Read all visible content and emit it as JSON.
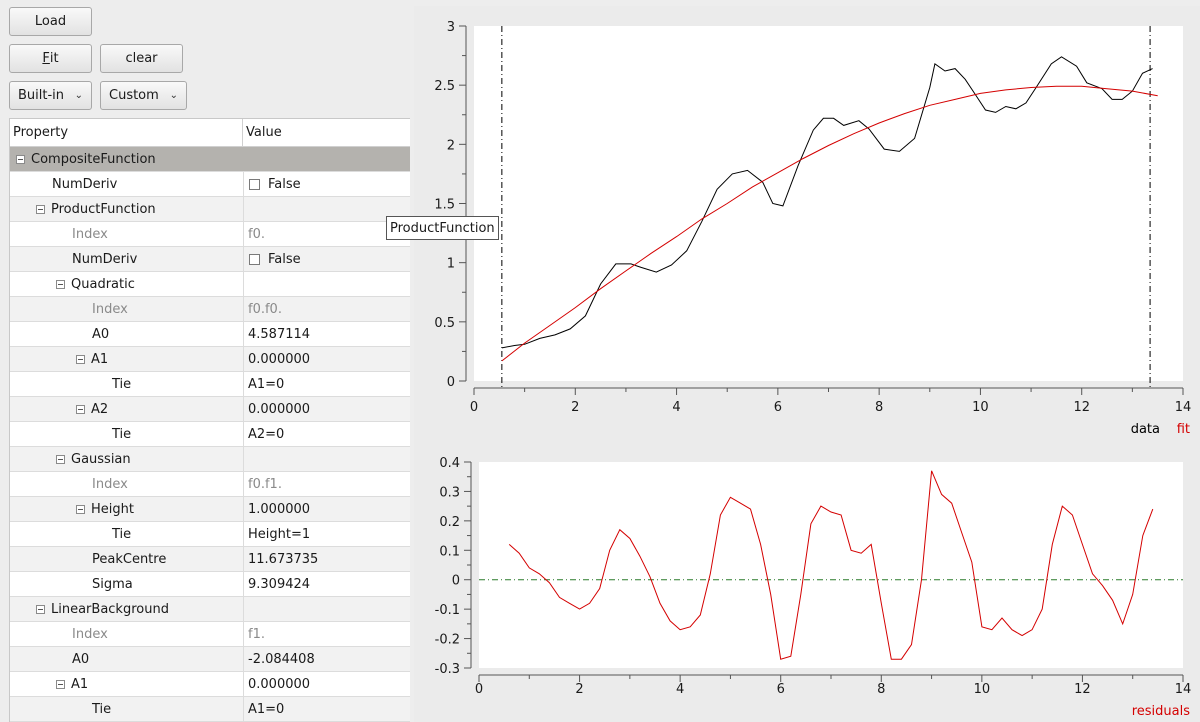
{
  "toolbar": {
    "load_label": "Load",
    "fit_label_underlined": "F",
    "fit_label_rest": "it",
    "clear_label": "clear",
    "builtin_label": "Built-in",
    "custom_label": "Custom"
  },
  "table": {
    "header_property": "Property",
    "header_value": "Value",
    "rows": [
      {
        "indent": 0,
        "label": "CompositeFunction",
        "value": "",
        "type": "group",
        "expander": true
      },
      {
        "indent": 1,
        "label": "NumDeriv",
        "value": "False",
        "type": "checkbox"
      },
      {
        "indent": 1,
        "label": "ProductFunction",
        "value": "",
        "expander": true
      },
      {
        "indent": 2,
        "label": "Index",
        "value": "f0.",
        "dim": true
      },
      {
        "indent": 2,
        "label": "NumDeriv",
        "value": "False",
        "type": "checkbox"
      },
      {
        "indent": 2,
        "label": "Quadratic",
        "value": "",
        "expander": true
      },
      {
        "indent": 3,
        "label": "Index",
        "value": "f0.f0.",
        "dim": true
      },
      {
        "indent": 3,
        "label": "A0",
        "value": "4.587114"
      },
      {
        "indent": 3,
        "label": "A1",
        "value": "0.000000",
        "expander": true
      },
      {
        "indent": 4,
        "label": "Tie",
        "value": "A1=0"
      },
      {
        "indent": 3,
        "label": "A2",
        "value": "0.000000",
        "expander": true
      },
      {
        "indent": 4,
        "label": "Tie",
        "value": "A2=0"
      },
      {
        "indent": 2,
        "label": "Gaussian",
        "value": "",
        "expander": true
      },
      {
        "indent": 3,
        "label": "Index",
        "value": "f0.f1.",
        "dim": true
      },
      {
        "indent": 3,
        "label": "Height",
        "value": "1.000000",
        "expander": true
      },
      {
        "indent": 4,
        "label": "Tie",
        "value": "Height=1"
      },
      {
        "indent": 3,
        "label": "PeakCentre",
        "value": "11.673735"
      },
      {
        "indent": 3,
        "label": "Sigma",
        "value": "9.309424"
      },
      {
        "indent": 1,
        "label": "LinearBackground",
        "value": "",
        "expander": true
      },
      {
        "indent": 2,
        "label": "Index",
        "value": "f1.",
        "dim": true
      },
      {
        "indent": 2,
        "label": "A0",
        "value": "-2.084408"
      },
      {
        "indent": 2,
        "label": "A1",
        "value": "0.000000",
        "expander": true
      },
      {
        "indent": 3,
        "label": "Tie",
        "value": "A1=0"
      }
    ]
  },
  "tooltip": "ProductFunction",
  "colors": {
    "data": "#000000",
    "fit": "#d40000",
    "residuals": "#d40000",
    "zero_line": "#2a7a2a",
    "marker": "#000000"
  },
  "chart_data": [
    {
      "type": "line",
      "xlim": [
        0,
        14
      ],
      "ylim": [
        0,
        3
      ],
      "xticks": [
        0,
        2,
        4,
        6,
        8,
        10,
        12,
        14
      ],
      "yticks": [
        0,
        0.5,
        1,
        1.5,
        2,
        2.5,
        3
      ],
      "legend": {
        "items": [
          "data",
          "fit"
        ],
        "placement": "bottom-right"
      },
      "range_markers": [
        0.55,
        13.35
      ],
      "series": [
        {
          "name": "data",
          "color": "#000000",
          "points": [
            [
              0.55,
              0.28
            ],
            [
              0.8,
              0.3
            ],
            [
              1.0,
              0.31
            ],
            [
              1.3,
              0.36
            ],
            [
              1.6,
              0.39
            ],
            [
              1.9,
              0.44
            ],
            [
              2.2,
              0.55
            ],
            [
              2.5,
              0.82
            ],
            [
              2.8,
              0.99
            ],
            [
              3.1,
              0.99
            ],
            [
              3.3,
              0.96
            ],
            [
              3.6,
              0.92
            ],
            [
              3.9,
              0.98
            ],
            [
              4.2,
              1.1
            ],
            [
              4.5,
              1.35
            ],
            [
              4.8,
              1.62
            ],
            [
              5.1,
              1.75
            ],
            [
              5.4,
              1.78
            ],
            [
              5.7,
              1.68
            ],
            [
              5.9,
              1.5
            ],
            [
              6.1,
              1.48
            ],
            [
              6.4,
              1.82
            ],
            [
              6.7,
              2.12
            ],
            [
              6.9,
              2.22
            ],
            [
              7.1,
              2.22
            ],
            [
              7.3,
              2.16
            ],
            [
              7.6,
              2.2
            ],
            [
              7.8,
              2.13
            ],
            [
              8.1,
              1.96
            ],
            [
              8.4,
              1.94
            ],
            [
              8.7,
              2.05
            ],
            [
              9.0,
              2.48
            ],
            [
              9.1,
              2.68
            ],
            [
              9.3,
              2.62
            ],
            [
              9.5,
              2.64
            ],
            [
              9.7,
              2.55
            ],
            [
              9.9,
              2.42
            ],
            [
              10.1,
              2.29
            ],
            [
              10.3,
              2.27
            ],
            [
              10.5,
              2.32
            ],
            [
              10.7,
              2.3
            ],
            [
              10.9,
              2.35
            ],
            [
              11.1,
              2.48
            ],
            [
              11.4,
              2.68
            ],
            [
              11.6,
              2.74
            ],
            [
              11.9,
              2.66
            ],
            [
              12.1,
              2.52
            ],
            [
              12.4,
              2.47
            ],
            [
              12.6,
              2.38
            ],
            [
              12.8,
              2.38
            ],
            [
              13.0,
              2.45
            ],
            [
              13.2,
              2.6
            ],
            [
              13.4,
              2.64
            ]
          ]
        },
        {
          "name": "fit",
          "color": "#d40000",
          "points": [
            [
              0.55,
              0.17
            ],
            [
              1.0,
              0.32
            ],
            [
              1.5,
              0.47
            ],
            [
              2.0,
              0.62
            ],
            [
              2.5,
              0.78
            ],
            [
              3.0,
              0.93
            ],
            [
              3.5,
              1.08
            ],
            [
              4.0,
              1.22
            ],
            [
              4.5,
              1.37
            ],
            [
              5.0,
              1.5
            ],
            [
              5.5,
              1.64
            ],
            [
              6.0,
              1.76
            ],
            [
              6.5,
              1.88
            ],
            [
              7.0,
              1.99
            ],
            [
              7.5,
              2.09
            ],
            [
              8.0,
              2.18
            ],
            [
              8.5,
              2.26
            ],
            [
              9.0,
              2.33
            ],
            [
              9.5,
              2.38
            ],
            [
              10.0,
              2.43
            ],
            [
              10.5,
              2.46
            ],
            [
              11.0,
              2.48
            ],
            [
              11.5,
              2.49
            ],
            [
              12.0,
              2.49
            ],
            [
              12.5,
              2.47
            ],
            [
              13.0,
              2.45
            ],
            [
              13.5,
              2.41
            ]
          ]
        }
      ]
    },
    {
      "type": "line",
      "xlim": [
        0,
        14
      ],
      "ylim": [
        -0.3,
        0.4
      ],
      "xticks": [
        0,
        2,
        4,
        6,
        8,
        10,
        12,
        14
      ],
      "yticks": [
        -0.3,
        -0.2,
        -0.1,
        0,
        0.1,
        0.2,
        0.3,
        0.4
      ],
      "legend": {
        "items": [
          "residuals"
        ],
        "placement": "bottom-right"
      },
      "zero_line": 0,
      "series": [
        {
          "name": "residuals",
          "color": "#d40000",
          "points": [
            [
              0.6,
              0.12
            ],
            [
              0.8,
              0.09
            ],
            [
              1.0,
              0.04
            ],
            [
              1.2,
              0.02
            ],
            [
              1.4,
              -0.01
            ],
            [
              1.6,
              -0.06
            ],
            [
              1.8,
              -0.08
            ],
            [
              2.0,
              -0.1
            ],
            [
              2.2,
              -0.08
            ],
            [
              2.4,
              -0.03
            ],
            [
              2.6,
              0.1
            ],
            [
              2.8,
              0.17
            ],
            [
              3.0,
              0.14
            ],
            [
              3.2,
              0.08
            ],
            [
              3.4,
              0.01
            ],
            [
              3.6,
              -0.08
            ],
            [
              3.8,
              -0.14
            ],
            [
              4.0,
              -0.17
            ],
            [
              4.2,
              -0.16
            ],
            [
              4.4,
              -0.12
            ],
            [
              4.6,
              0.02
            ],
            [
              4.8,
              0.22
            ],
            [
              5.0,
              0.28
            ],
            [
              5.2,
              0.26
            ],
            [
              5.4,
              0.24
            ],
            [
              5.6,
              0.12
            ],
            [
              5.8,
              -0.05
            ],
            [
              6.0,
              -0.27
            ],
            [
              6.2,
              -0.26
            ],
            [
              6.4,
              -0.05
            ],
            [
              6.6,
              0.19
            ],
            [
              6.8,
              0.25
            ],
            [
              7.0,
              0.23
            ],
            [
              7.2,
              0.22
            ],
            [
              7.4,
              0.1
            ],
            [
              7.6,
              0.09
            ],
            [
              7.8,
              0.12
            ],
            [
              8.0,
              -0.08
            ],
            [
              8.2,
              -0.27
            ],
            [
              8.4,
              -0.27
            ],
            [
              8.6,
              -0.22
            ],
            [
              8.8,
              0.0
            ],
            [
              9.0,
              0.37
            ],
            [
              9.2,
              0.29
            ],
            [
              9.4,
              0.26
            ],
            [
              9.6,
              0.16
            ],
            [
              9.8,
              0.06
            ],
            [
              10.0,
              -0.16
            ],
            [
              10.2,
              -0.17
            ],
            [
              10.4,
              -0.13
            ],
            [
              10.6,
              -0.17
            ],
            [
              10.8,
              -0.19
            ],
            [
              11.0,
              -0.17
            ],
            [
              11.2,
              -0.1
            ],
            [
              11.4,
              0.12
            ],
            [
              11.6,
              0.25
            ],
            [
              11.8,
              0.22
            ],
            [
              12.0,
              0.12
            ],
            [
              12.2,
              0.02
            ],
            [
              12.4,
              -0.02
            ],
            [
              12.6,
              -0.07
            ],
            [
              12.8,
              -0.15
            ],
            [
              13.0,
              -0.05
            ],
            [
              13.2,
              0.15
            ],
            [
              13.4,
              0.24
            ]
          ]
        }
      ]
    }
  ]
}
